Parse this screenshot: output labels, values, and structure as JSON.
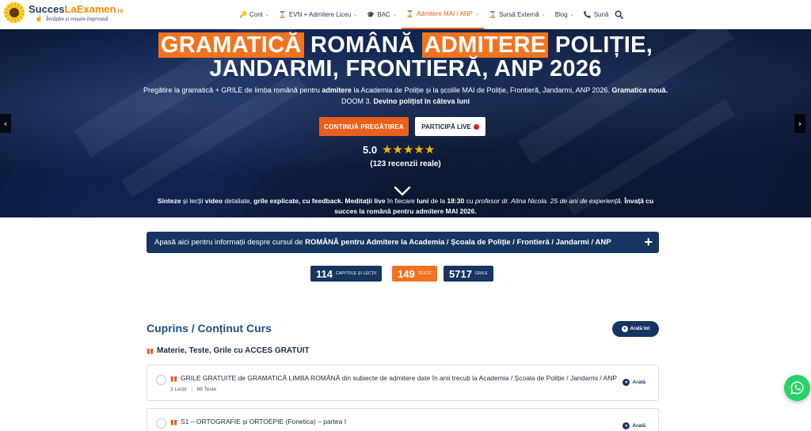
{
  "header": {
    "logo": {
      "part1": "Succes",
      "part2": "LaExamen",
      "tld": ".ro",
      "tagline": "Învățăm și reușim împreună"
    },
    "nav": [
      {
        "icon": "🔑",
        "label": "Cont",
        "chevron": true
      },
      {
        "icon": "⌛",
        "label": "EVN + Admitere Liceu",
        "chevron": true
      },
      {
        "icon": "🎓",
        "label": "BAC",
        "chevron": true
      },
      {
        "icon": "⌛",
        "label": "Admitere MAI / ANP",
        "chevron": true,
        "active": true
      },
      {
        "icon": "⌛",
        "label": "Sursă Externă",
        "chevron": true
      },
      {
        "icon": "",
        "label": "Blog",
        "chevron": true
      },
      {
        "icon": "📞",
        "label": "Sună",
        "chevron": false
      }
    ]
  },
  "hero": {
    "title_parts": [
      "GRAMATICĂ",
      " ROMÂNĂ ",
      "ADMITERE",
      " POLIȚIE,"
    ],
    "title_line2": "JANDARMI, FRONTIERĂ, ANP 2026",
    "desc": {
      "p1": "Pregătire la gramatică + GRILE de limba română pentru ",
      "b1": "admitere",
      "p2": " la Academia de Poliție și la școlile MAI de Poliție, Frontieră, Jandarmi, ANP 2026. ",
      "b2": "Gramatica nouă.",
      "p3": " DOOM 3. ",
      "b3": "Devino polițist în câteva luni"
    },
    "btn_continue": "CONTINUĂ PREGĂTIREA",
    "btn_live": "PARTICIPĂ LIVE",
    "rating_value": "5.0",
    "stars": "★★★★★",
    "reviews": "(123 recenzii reale)",
    "footer": {
      "b1": "Sinteze",
      "t1": " și lecții ",
      "b2": "video",
      "t2": " detaliate, ",
      "b3": "grile explicate, cu feedback.",
      "t3": " ",
      "b4": "Meditații live",
      "t4": " în fiecare ",
      "b5": "luni",
      "t5": " de la ",
      "b6": "18:30",
      "t6": " cu ",
      "i1": "profesor dr. Alina Nicola. 25 de ani de experiență.",
      "t7": " ",
      "b7": "Învață cu succes la română pentru admitere MAI 2026."
    }
  },
  "info_bar": {
    "text_before": "Apasă aici pentru informații despre cursul de ",
    "text_bold": "ROMÂNĂ pentru Admitere la Academia / Școala de Poliție / Frontieră / Jandarmi / ANP",
    "plus": "+"
  },
  "stats": [
    {
      "number": "114",
      "label": "CAPITOLE ȘI LECȚII",
      "color": "#173562"
    },
    {
      "number": "149",
      "label": "TESTE",
      "color": "#f2731f"
    },
    {
      "number": "5717",
      "label": "GRILE",
      "color": "#173562"
    }
  ],
  "content": {
    "title": "Cuprins / Conținut Curs",
    "expand_all": "Arată tot",
    "section_title": "Materie, Teste, Grile cu ACCES GRATUIT",
    "items": [
      {
        "title": "GRILE GRATUITE de GRAMATICĂ LIMBA ROMÂNĂ din subiecte de admitere date în anii trecuți la Academia / Școala de Poliție / Jandarmi / ANP",
        "lessons": "3 Lecții",
        "tests": "88 Teste",
        "show": "Arată"
      },
      {
        "title": "S1 – ORTOGRAFIE și ORTOEPIE (Fonetica) – partea I",
        "show": "Arată"
      }
    ]
  },
  "colors": {
    "navy": "#173562",
    "orange": "#e8601c",
    "whatsapp": "#25d366"
  }
}
